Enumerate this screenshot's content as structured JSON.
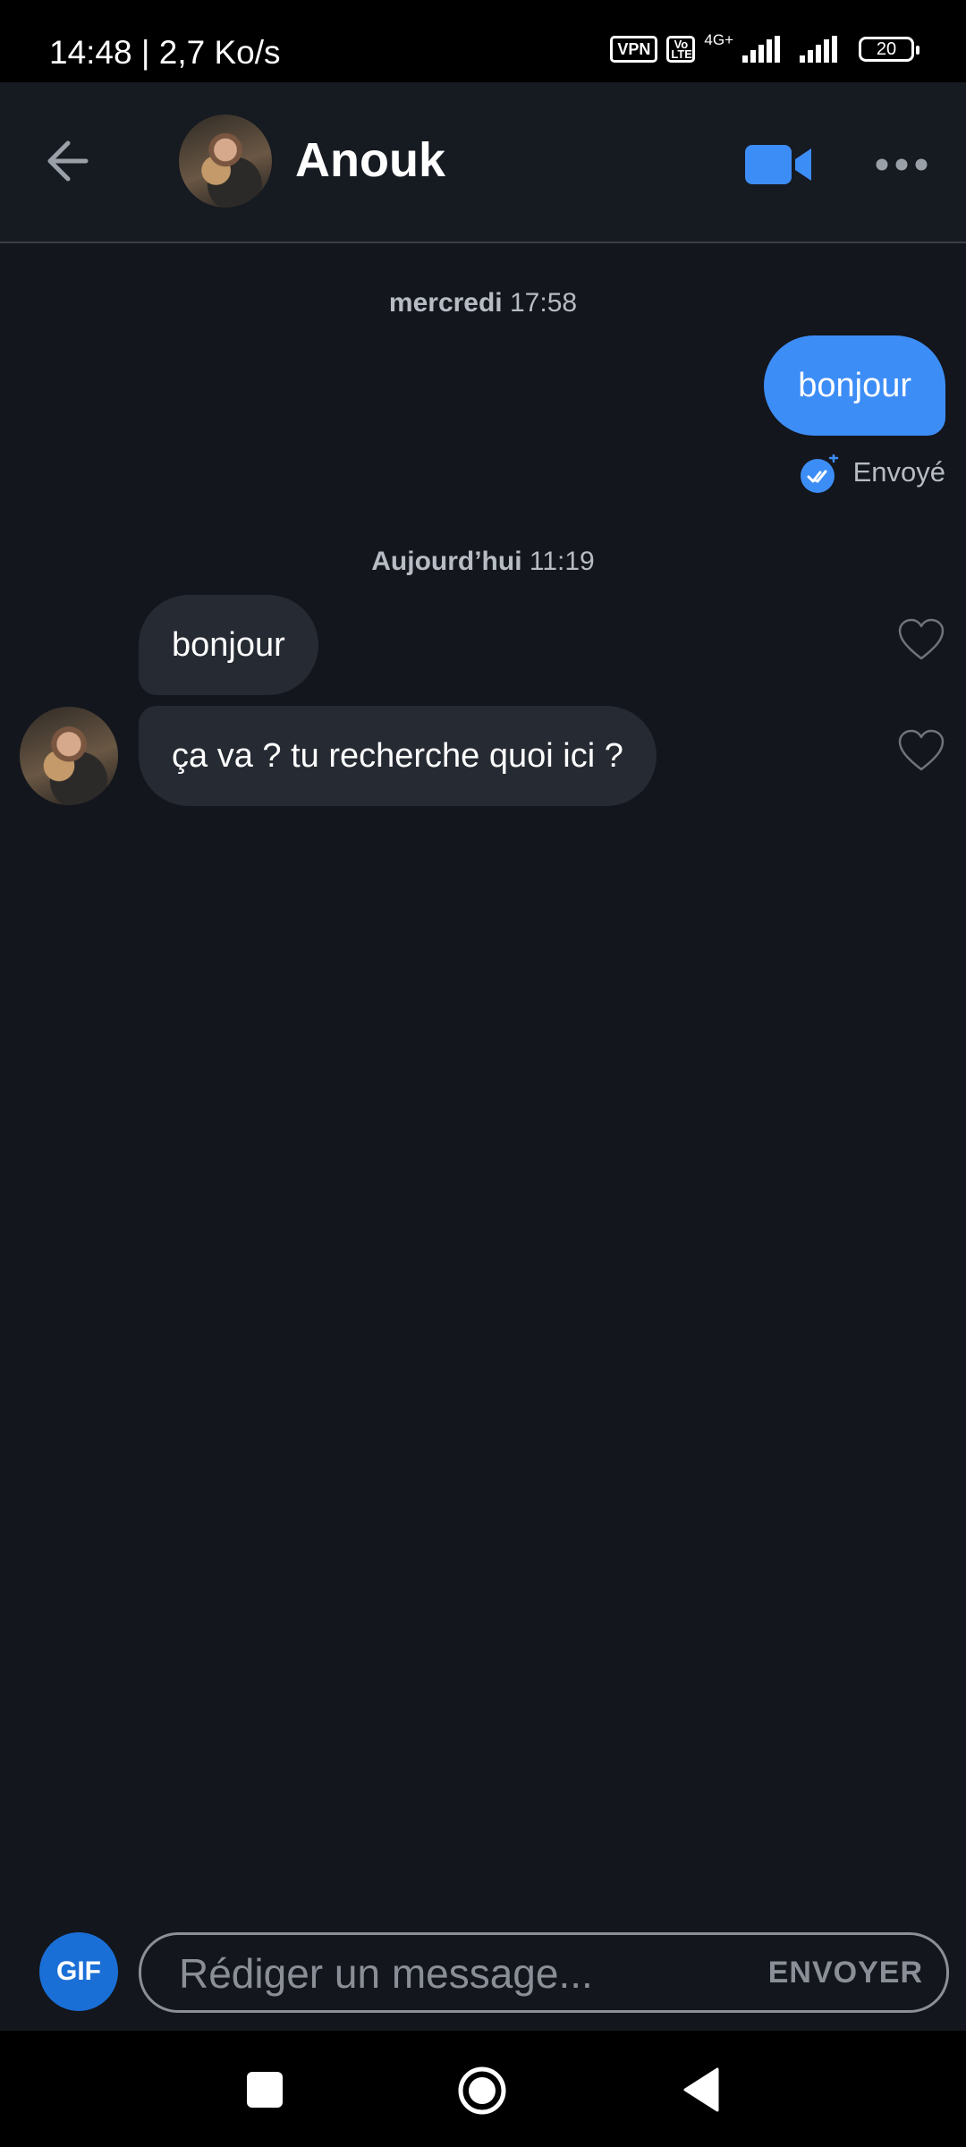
{
  "status_bar": {
    "time": "14:48 | 2,7 Ko/s",
    "vpn": "VPN",
    "volte": "Vo LTE",
    "network": "4G+",
    "battery": "20"
  },
  "header": {
    "contact_name": "Anouk",
    "icons": {
      "back": "arrow-left-icon",
      "video": "video-camera-icon",
      "more": "more-dots-icon"
    },
    "accent": "#3d8df6"
  },
  "chat": {
    "separators": [
      {
        "day": "mercredi",
        "time": "17:58"
      },
      {
        "day": "Aujourd’hui",
        "time": "11:19"
      }
    ],
    "outgoing": [
      {
        "text": "bonjour",
        "status": "Envoyé"
      }
    ],
    "incoming": [
      {
        "text": "bonjour"
      },
      {
        "text": "ça va ? tu recherche quoi ici ?"
      }
    ]
  },
  "composer": {
    "gif_label": "GIF",
    "placeholder": "Rédiger un message...",
    "send_label": "ENVOYER"
  },
  "nav": {
    "icons": [
      "recents-square-icon",
      "home-circle-icon",
      "back-triangle-icon"
    ]
  }
}
